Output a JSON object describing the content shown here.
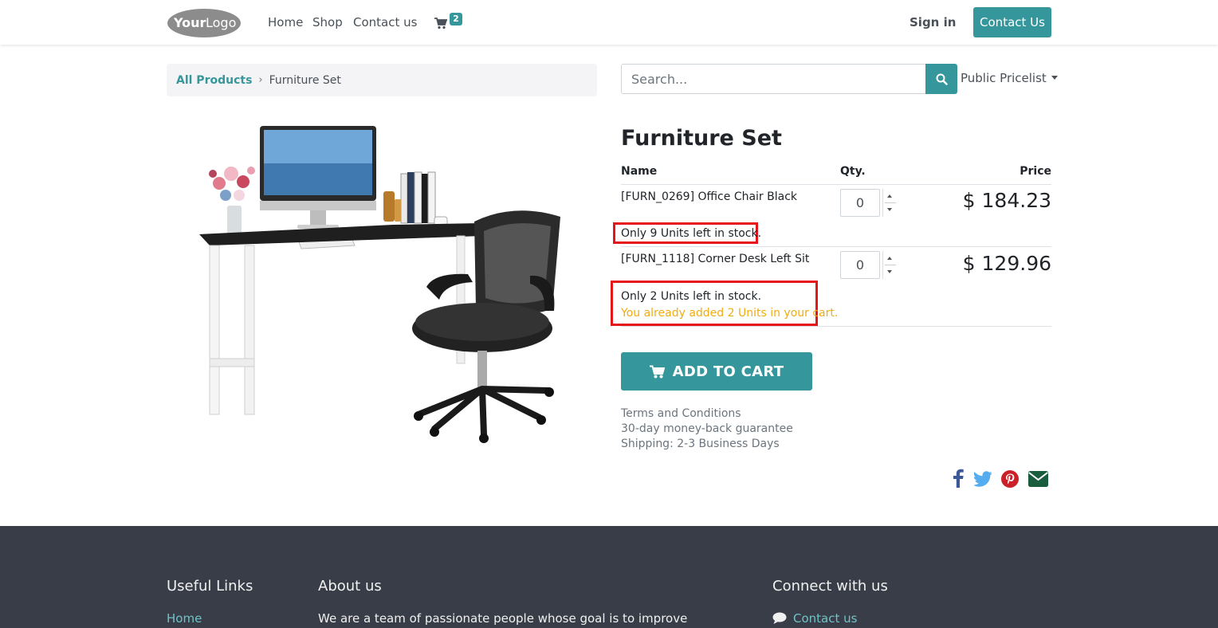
{
  "header": {
    "logo_alt": "YourLogo",
    "nav": [
      "Home",
      "Shop",
      "Contact us"
    ],
    "cart_count": "2",
    "signin": "Sign in",
    "contact_button": "Contact Us"
  },
  "breadcrumb": {
    "parent": "All Products",
    "current": "Furniture Set"
  },
  "search": {
    "placeholder": "Search...",
    "pricelist": "Public Pricelist"
  },
  "product": {
    "title": "Furniture Set",
    "columns": {
      "name": "Name",
      "qty": "Qty.",
      "price": "Price"
    },
    "items": [
      {
        "name": "[FURN_0269] Office Chair Black",
        "qty": "0",
        "price": "$ 184.23",
        "stock": "Only 9 Units left in stock.",
        "cart_note": ""
      },
      {
        "name": "[FURN_1118] Corner Desk Left Sit",
        "qty": "0",
        "price": "$ 129.96",
        "stock": "Only 2 Units left in stock.",
        "cart_note": "You already added 2 Units in your cart."
      }
    ],
    "add_to_cart": "ADD TO CART",
    "info": [
      "Terms and Conditions",
      "30-day money-back guarantee",
      "Shipping: 2-3 Business Days"
    ]
  },
  "share_icons": [
    "facebook-icon",
    "twitter-icon",
    "pinterest-icon",
    "email-icon"
  ],
  "footer": {
    "useful_links_title": "Useful Links",
    "useful_links_first": "Home",
    "about_title": "About us",
    "about_text": "We are a team of passionate people whose goal is to improve",
    "connect_title": "Connect with us",
    "connect_first": "Contact us"
  },
  "colors": {
    "accent": "#35979c",
    "highlight_box": "#e8141c",
    "warning_text": "#f0ad10",
    "footer_bg": "#393d47"
  }
}
